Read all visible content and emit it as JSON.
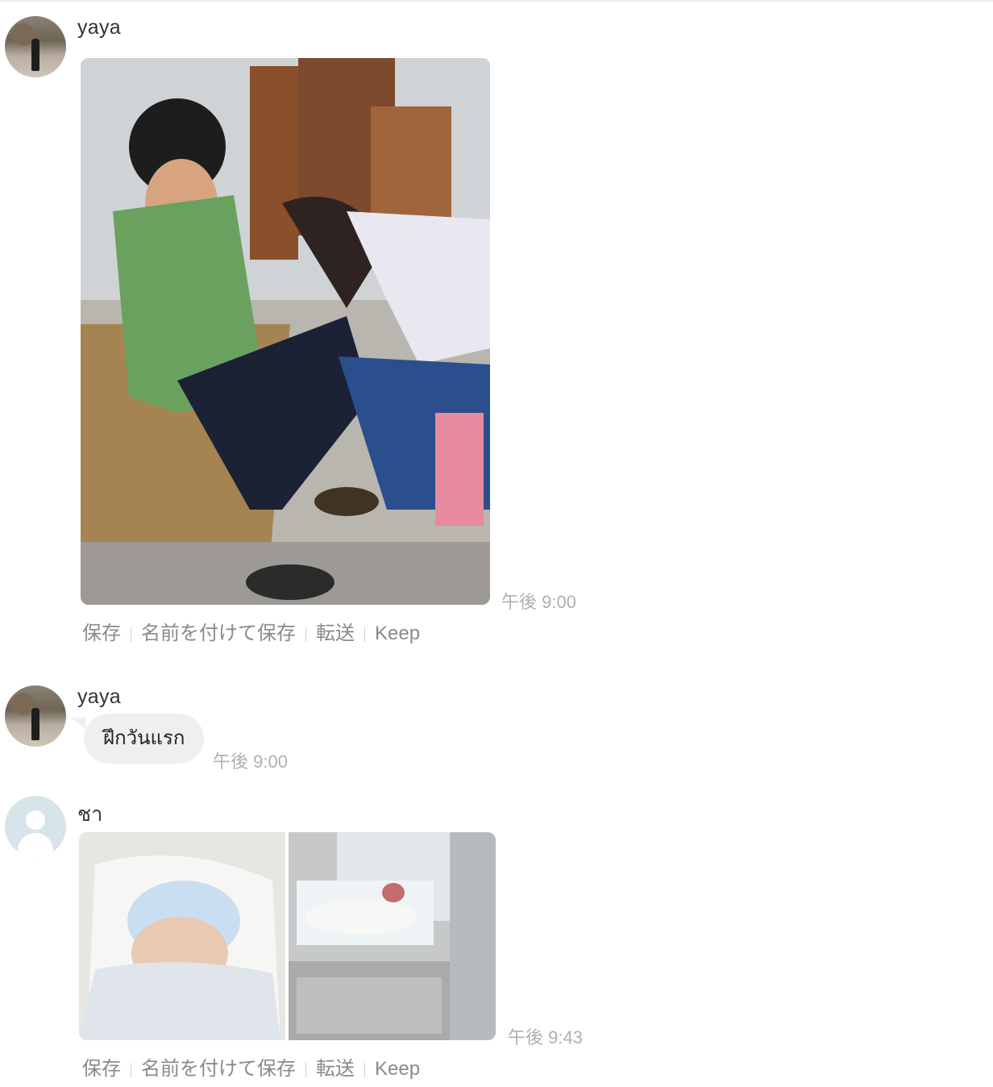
{
  "messages": [
    {
      "sender": "yaya",
      "type": "image",
      "time": "午後 9:00",
      "actions": [
        "保存",
        "名前を付けて保存",
        "転送",
        "Keep"
      ]
    },
    {
      "sender": "yaya",
      "type": "text",
      "text": "ฝึกวันแรก",
      "time": "午後 9:00"
    },
    {
      "sender": "ชา",
      "type": "images",
      "time": "午後 9:43",
      "actions": [
        "保存",
        "名前を付けて保存",
        "転送",
        "Keep"
      ]
    }
  ],
  "colors": {
    "bubble": "#efefef",
    "time": "#b0b0b0",
    "actions": "#8a8a8a"
  }
}
